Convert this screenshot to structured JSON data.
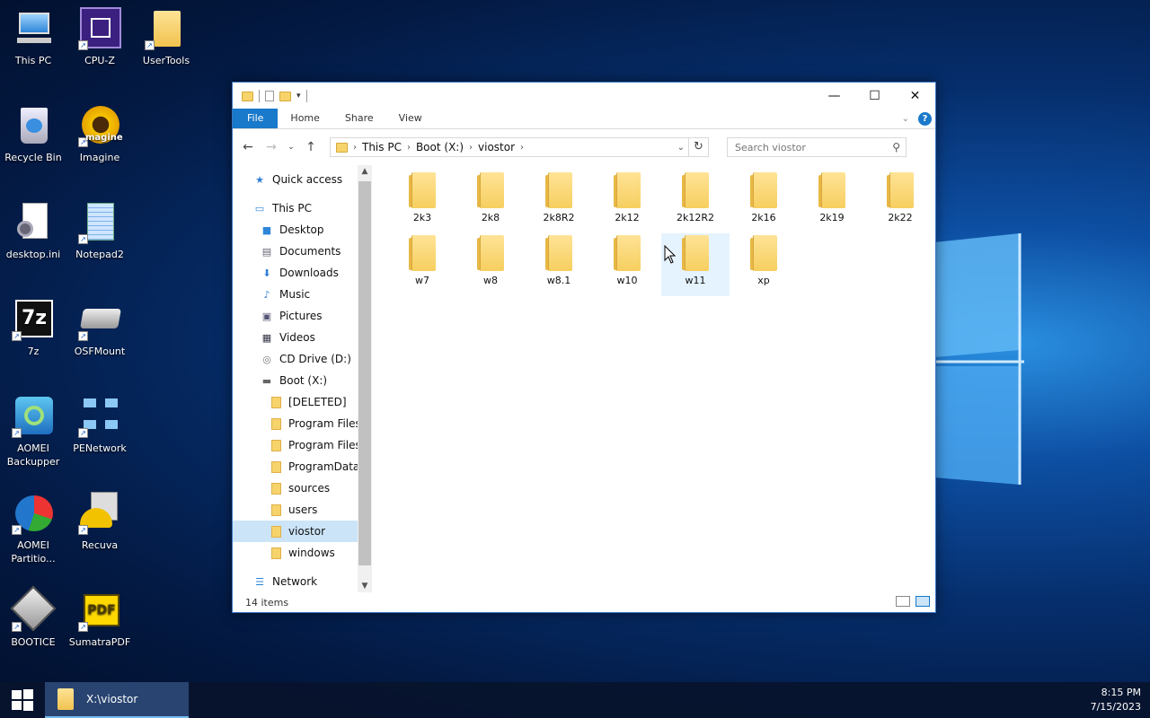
{
  "desktop": {
    "icons": [
      {
        "label": "This PC",
        "icon": "computer-icon"
      },
      {
        "label": "CPU-Z",
        "icon": "cpu-icon"
      },
      {
        "label": "UserTools",
        "icon": "folder-icon"
      },
      {
        "label": "Recycle Bin",
        "icon": "recycle-bin-icon"
      },
      {
        "label": "Imagine",
        "icon": "sunflower-icon"
      },
      {
        "label": "desktop.ini",
        "icon": "settings-file-icon"
      },
      {
        "label": "Notepad2",
        "icon": "notepad-icon"
      },
      {
        "label": "7z",
        "icon": "7zip-icon"
      },
      {
        "label": "OSFMount",
        "icon": "drive-icon"
      },
      {
        "label": "AOMEI Backupper",
        "icon": "backup-icon"
      },
      {
        "label": "PENetwork",
        "icon": "network-icon"
      },
      {
        "label": "AOMEI Partitio...",
        "icon": "partition-icon"
      },
      {
        "label": "Recuva",
        "icon": "recuva-icon"
      },
      {
        "label": "BOOTICE",
        "icon": "bootice-icon"
      },
      {
        "label": "SumatraPDF",
        "icon": "pdf-icon"
      }
    ],
    "imagine_overlay": "magine"
  },
  "window": {
    "ribbon_tabs": [
      "File",
      "Home",
      "Share",
      "View"
    ],
    "help": "?",
    "breadcrumb": [
      "This PC",
      "Boot (X:)",
      "viostor"
    ],
    "search_placeholder": "Search viostor",
    "nav_items": [
      {
        "label": "Quick access",
        "icon": "star-icon",
        "indent": 0
      },
      {
        "label": "This PC",
        "icon": "computer-icon",
        "indent": 0
      },
      {
        "label": "Desktop",
        "icon": "desktop-icon",
        "indent": 1
      },
      {
        "label": "Documents",
        "icon": "documents-icon",
        "indent": 1
      },
      {
        "label": "Downloads",
        "icon": "download-icon",
        "indent": 1
      },
      {
        "label": "Music",
        "icon": "music-icon",
        "indent": 1
      },
      {
        "label": "Pictures",
        "icon": "pictures-icon",
        "indent": 1
      },
      {
        "label": "Videos",
        "icon": "videos-icon",
        "indent": 1
      },
      {
        "label": "CD Drive (D:)",
        "icon": "cd-drive-icon",
        "indent": 1
      },
      {
        "label": "Boot (X:)",
        "icon": "drive-icon",
        "indent": 1
      },
      {
        "label": "[DELETED]",
        "icon": "folder-icon",
        "indent": 2
      },
      {
        "label": "Program Files",
        "icon": "folder-icon",
        "indent": 2
      },
      {
        "label": "Program Files (",
        "icon": "folder-icon",
        "indent": 2
      },
      {
        "label": "ProgramData",
        "icon": "folder-icon",
        "indent": 2
      },
      {
        "label": "sources",
        "icon": "folder-icon",
        "indent": 2
      },
      {
        "label": "users",
        "icon": "folder-icon",
        "indent": 2
      },
      {
        "label": "viostor",
        "icon": "folder-icon",
        "indent": 2,
        "selected": true
      },
      {
        "label": "windows",
        "icon": "folder-icon",
        "indent": 2
      },
      {
        "label": "Network",
        "icon": "network-icon",
        "indent": 0
      }
    ],
    "folders": [
      "2k3",
      "2k8",
      "2k8R2",
      "2k12",
      "2k12R2",
      "2k16",
      "2k19",
      "2k22",
      "w7",
      "w8",
      "w8.1",
      "w10",
      "w11",
      "xp"
    ],
    "hovered_folder": "w11",
    "status": "14 items"
  },
  "taskbar": {
    "task_label": "X:\\viostor",
    "time": "8:15 PM",
    "date": "7/15/2023"
  }
}
